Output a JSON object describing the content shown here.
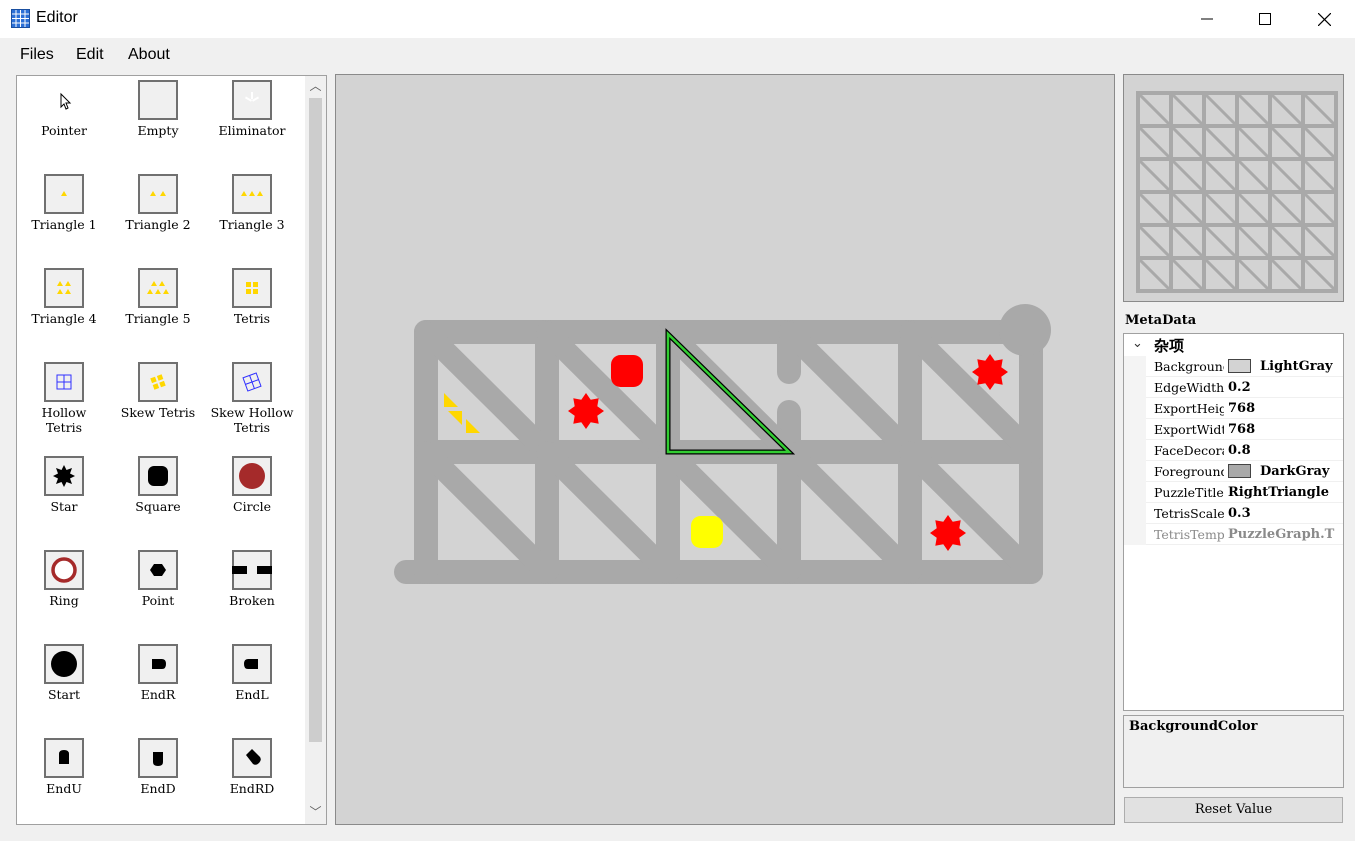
{
  "window": {
    "title": "Editor",
    "controls": [
      "minimize",
      "maximize",
      "close"
    ]
  },
  "menu": {
    "items": [
      "Files",
      "Edit",
      "About"
    ]
  },
  "toolbox": {
    "tools": [
      {
        "label": "Pointer",
        "icon": "pointer-icon"
      },
      {
        "label": "Empty",
        "icon": "empty-icon"
      },
      {
        "label": "Eliminator",
        "icon": "eliminator-icon"
      },
      {
        "label": "Triangle 1",
        "icon": "triangle-1-icon"
      },
      {
        "label": "Triangle 2",
        "icon": "triangle-2-icon"
      },
      {
        "label": "Triangle 3",
        "icon": "triangle-3-icon"
      },
      {
        "label": "Triangle 4",
        "icon": "triangle-4-icon"
      },
      {
        "label": "Triangle 5",
        "icon": "triangle-5-icon"
      },
      {
        "label": "Tetris",
        "icon": "tetris-icon"
      },
      {
        "label": "Hollow\nTetris",
        "icon": "hollow-tetris-icon"
      },
      {
        "label": "Skew Tetris",
        "icon": "skew-tetris-icon"
      },
      {
        "label": "Skew Hollow\nTetris",
        "icon": "skew-hollow-tetris-icon"
      },
      {
        "label": "Star",
        "icon": "star-icon"
      },
      {
        "label": "Square",
        "icon": "square-icon"
      },
      {
        "label": "Circle",
        "icon": "circle-icon"
      },
      {
        "label": "Ring",
        "icon": "ring-icon"
      },
      {
        "label": "Point",
        "icon": "point-icon"
      },
      {
        "label": "Broken",
        "icon": "broken-icon"
      },
      {
        "label": "Start",
        "icon": "start-icon"
      },
      {
        "label": "EndR",
        "icon": "end-right-icon"
      },
      {
        "label": "EndL",
        "icon": "end-left-icon"
      },
      {
        "label": "EndU",
        "icon": "end-up-icon"
      },
      {
        "label": "EndD",
        "icon": "end-down-icon"
      },
      {
        "label": "EndRD",
        "icon": "end-right-down-icon"
      }
    ]
  },
  "colors": {
    "canvas_background": "#d3d3d3",
    "grid_foreground": "#a9a9a9",
    "triangle": "#ffd700",
    "star": "#ff0000",
    "square_red": "#ff0000",
    "square_yellow": "#ffff00",
    "highlight": "#32cd32"
  },
  "metadata": {
    "title": "MetaData",
    "category": "杂项",
    "properties": [
      {
        "name": "BackgroundColor",
        "value": "LightGray",
        "swatch": "#d3d3d3",
        "disabled": false
      },
      {
        "name": "EdgeWidth",
        "value": "0.2",
        "swatch": null,
        "disabled": false
      },
      {
        "name": "ExportHeight",
        "value": "768",
        "swatch": null,
        "disabled": false
      },
      {
        "name": "ExportWidth",
        "value": "768",
        "swatch": null,
        "disabled": false
      },
      {
        "name": "FaceDecorationScale",
        "value": "0.8",
        "swatch": null,
        "disabled": false
      },
      {
        "name": "ForegroundColor",
        "value": "DarkGray",
        "swatch": "#a9a9a9",
        "disabled": false
      },
      {
        "name": "PuzzleTitle",
        "value": "RightTriangle",
        "swatch": null,
        "disabled": false
      },
      {
        "name": "TetrisScale",
        "value": "0.3",
        "swatch": null,
        "disabled": false
      },
      {
        "name": "TetrisTemplate",
        "value": "PuzzleGraph.T",
        "swatch": null,
        "disabled": true
      }
    ],
    "description": "BackgroundColor",
    "reset_label": "Reset Value"
  }
}
